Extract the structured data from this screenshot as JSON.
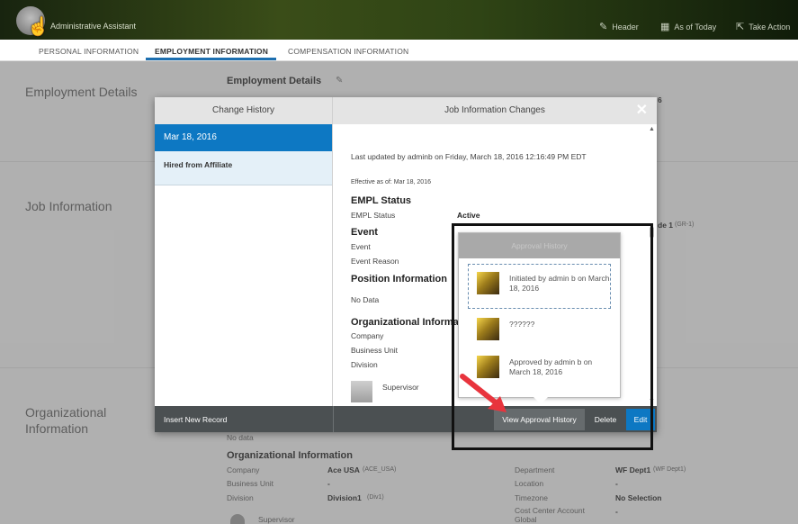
{
  "header": {
    "role": "Administrative Assistant",
    "actions": [
      {
        "icon": "pencil-icon",
        "glyph": "✎",
        "label": "Header"
      },
      {
        "icon": "calendar-icon",
        "glyph": "▦",
        "label": "As of Today"
      },
      {
        "icon": "share-icon",
        "glyph": "⇱",
        "label": "Take Action"
      }
    ]
  },
  "tabs": [
    {
      "label": "PERSONAL INFORMATION",
      "active": false
    },
    {
      "label": "EMPLOYMENT INFORMATION",
      "active": true
    },
    {
      "label": "COMPENSATION INFORMATION",
      "active": false
    }
  ],
  "page": {
    "sections": [
      "Employment Details",
      "Job Information",
      "Organizational Information"
    ],
    "employment_details_heading": "Employment Details",
    "bg_fragments": {
      "six": "6",
      "grade": "de 1",
      "grade_code": "(GR-1)",
      "no_data": "No data",
      "org_heading": "Organizational Information",
      "company_label": "Company",
      "company_value": "Ace USA",
      "company_code": "(ACE_USA)",
      "bu_label": "Business Unit",
      "bu_value": "-",
      "division_label": "Division",
      "division_value": "Division1",
      "division_code": "(Div1)",
      "supervisor_label": "Supervisor",
      "department_label": "Department",
      "department_value": "WF Dept1",
      "department_code": "(WF Dept1)",
      "location_label": "Location",
      "location_value": "-",
      "timezone_label": "Timezone",
      "timezone_value": "No Selection",
      "cost_center_label": "Cost Center Account Global",
      "cost_center_value": "-"
    }
  },
  "modal": {
    "left_title": "Change History",
    "right_title": "Job Information Changes",
    "close_glyph": "✕",
    "history": [
      {
        "date": "Mar 18, 2016",
        "selected": true
      },
      {
        "label": "Hired from Affiliate",
        "selected": false
      }
    ],
    "last_updated": "Last updated by adminb on Friday, March 18, 2016 12:16:49 PM EDT",
    "effective": "Effective as of: Mar 18, 2016",
    "empl_status_heading": "EMPL Status",
    "empl_status_label": "EMPL Status",
    "empl_status_value": "Active",
    "event_heading": "Event",
    "event_label": "Event",
    "event_reason_label": "Event Reason",
    "position_heading": "Position Information",
    "position_value": "No Data",
    "org_heading": "Organizational Informa",
    "company_label": "Company",
    "bu_label": "Business Unit",
    "division_label": "Division",
    "supervisor_label": "Supervisor",
    "footer": {
      "insert": "Insert New Record",
      "view_approval": "View Approval History",
      "delete": "Delete",
      "edit": "Edit"
    }
  },
  "approval": {
    "title": "Approval History",
    "entries": [
      {
        "text": "Initiated by admin b on March 18, 2016"
      },
      {
        "text": "??????"
      },
      {
        "text": "Approved by admin b on March 18, 2016"
      }
    ]
  },
  "colors": {
    "accent_blue": "#0d78c3",
    "annotation_arrow": "#e8343d",
    "footer_bar": "#4b5052"
  }
}
